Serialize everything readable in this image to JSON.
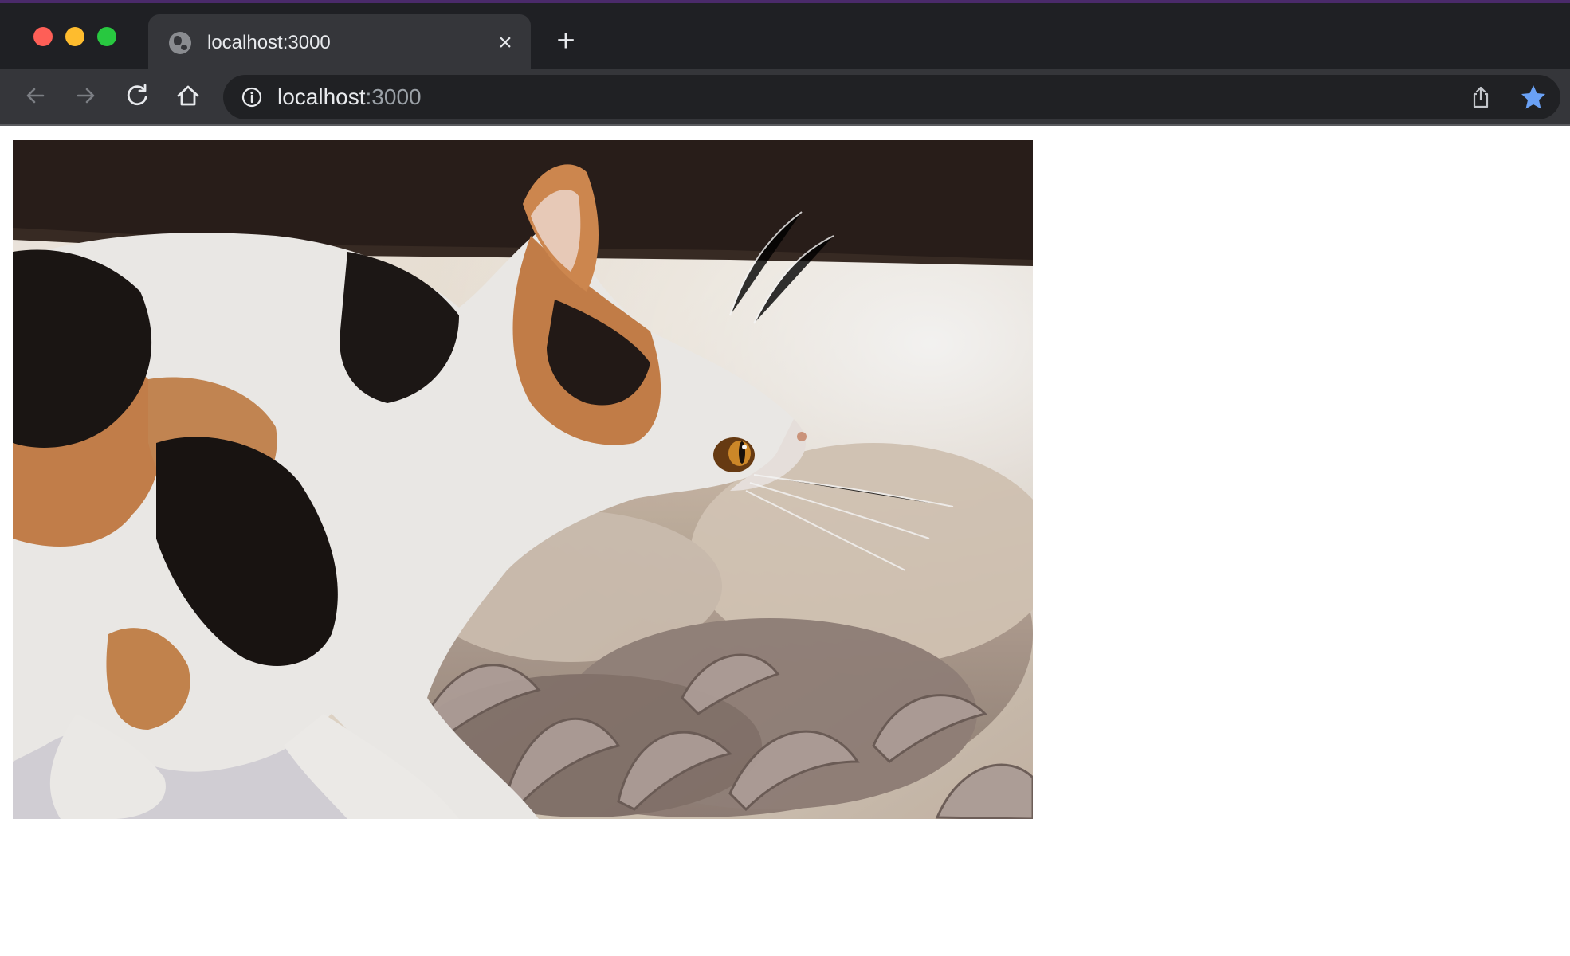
{
  "window": {
    "traffic_lights": {
      "close_color": "#fe5f57",
      "minimize_color": "#febc2e",
      "maximize_color": "#28c840"
    }
  },
  "tabs": [
    {
      "title": "localhost:3000",
      "active": true,
      "favicon": "globe-icon",
      "close_icon": "close-icon"
    }
  ],
  "new_tab_icon": "plus-icon",
  "toolbar": {
    "back_icon": "arrow-left-icon",
    "forward_icon": "arrow-right-icon",
    "reload_icon": "reload-icon",
    "home_icon": "home-icon"
  },
  "omnibox": {
    "site_info_icon": "info-icon",
    "url_host": "localhost",
    "url_port": ":3000",
    "share_icon": "share-icon",
    "bookmark_icon": "star-icon",
    "bookmark_color": "#6aa1f5"
  },
  "page": {
    "image": {
      "subject": "calico kitten",
      "icon": "photo-image"
    }
  },
  "colors": {
    "tabbar_bg": "#1f2024",
    "toolbar_bg": "#35363a",
    "omnibox_bg": "#202124",
    "text": "#e8eaed",
    "muted_text": "#9aa0a6",
    "page_bg": "#ffffff"
  }
}
